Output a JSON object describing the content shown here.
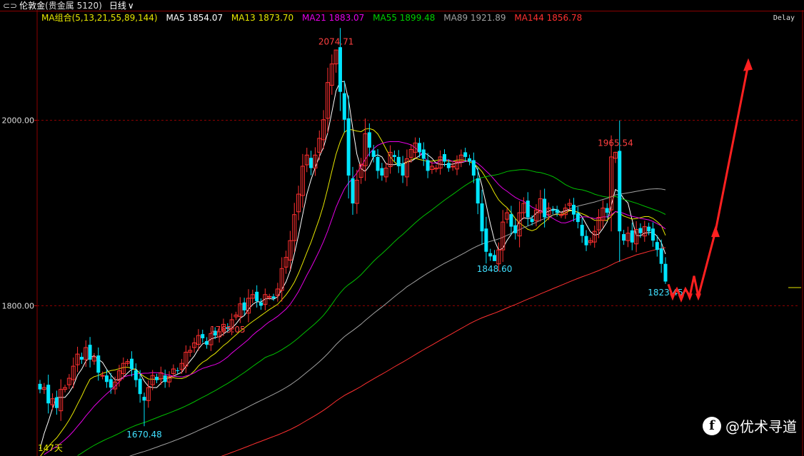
{
  "header": {
    "icon": "link-icon",
    "instrument": "伦敦金",
    "market": "(贵金属 5120)",
    "period": "日线",
    "dropdown_icon": "chevron-down-icon"
  },
  "ma_bar": {
    "label": "MA组合(5,13,21,55,89,144)",
    "items": [
      {
        "text": "MA5 1854.07",
        "color": "#ffffff"
      },
      {
        "text": "MA13 1873.70",
        "color": "#e6e600"
      },
      {
        "text": "MA21 1883.07",
        "color": "#e600e6"
      },
      {
        "text": "MA55 1899.48",
        "color": "#00d000"
      },
      {
        "text": "MA89 1921.89",
        "color": "#a0a0a0"
      },
      {
        "text": "MA144 1856.78",
        "color": "#ff3030"
      }
    ],
    "label_color": "#e6e600"
  },
  "delay_label": "Delay",
  "day_count": "147天",
  "watermark": {
    "logo": "f",
    "text": "@优术寻道"
  },
  "colors": {
    "up": "#ff3030",
    "down": "#00e5ff",
    "grid": "#8b0000"
  },
  "chart_data": {
    "type": "candlestick",
    "ylim": [
      1643,
      2118
    ],
    "y_ticks": [
      {
        "value": 2000,
        "label": "2000.00"
      },
      {
        "value": 1800,
        "label": "1800.00"
      }
    ],
    "grid_lines": [
      2000,
      1800
    ],
    "ohlc_close": [
      1710,
      1712,
      1695,
      1700,
      1690,
      1710,
      1712,
      1722,
      1735,
      1748,
      1742,
      1755,
      1742,
      1745,
      1728,
      1725,
      1718,
      1712,
      1718,
      1730,
      1738,
      1740,
      1732,
      1720,
      1705,
      1698,
      1712,
      1725,
      1720,
      1728,
      1718,
      1724,
      1732,
      1730,
      1738,
      1750,
      1752,
      1760,
      1768,
      1765,
      1758,
      1770,
      1768,
      1772,
      1780,
      1775,
      1785,
      1790,
      1802,
      1795,
      1808,
      1812,
      1805,
      1800,
      1812,
      1810,
      1808,
      1818,
      1840,
      1852,
      1870,
      1898,
      1920,
      1950,
      1962,
      1948,
      1962,
      1980,
      2000,
      2040,
      2060,
      2075,
      2030,
      2000,
      1940,
      1910,
      1935,
      1952,
      1985,
      1970,
      1960,
      1945,
      1940,
      1948,
      1965,
      1960,
      1950,
      1940,
      1958,
      1968,
      1975,
      1965,
      1958,
      1945,
      1950,
      1948,
      1960,
      1955,
      1948,
      1950,
      1955,
      1962,
      1960,
      1955,
      1940,
      1910,
      1880,
      1858,
      1853,
      1848,
      1860,
      1890,
      1900,
      1885,
      1878,
      1900,
      1910,
      1895,
      1890,
      1903,
      1915,
      1895,
      1905,
      1902,
      1900,
      1898,
      1905,
      1910,
      1898,
      1890,
      1875,
      1865,
      1870,
      1880,
      1895,
      1905,
      1900,
      1960,
      1965,
      1880,
      1870,
      1878,
      1868,
      1882,
      1878,
      1885,
      1880,
      1870,
      1860,
      1845,
      1823
    ],
    "annotations": [
      {
        "label": "2074.71",
        "value": 2074.71,
        "type": "high",
        "color": "#ff4040"
      },
      {
        "label": "1765.05",
        "value": 1765.05,
        "type": "high",
        "color": "#ff4040"
      },
      {
        "label": "1965.54",
        "value": 1965.54,
        "type": "high",
        "color": "#ff4040"
      },
      {
        "label": "1848.60",
        "value": 1848.6,
        "type": "low",
        "color": "#40e0ff"
      },
      {
        "label": "1670.48",
        "value": 1670.48,
        "type": "low",
        "color": "#40e0ff"
      },
      {
        "label": "1823.45",
        "value": 1823.45,
        "type": "low",
        "color": "#40e0ff"
      }
    ],
    "moving_averages": [
      {
        "name": "MA5",
        "period": 5,
        "color": "#ffffff"
      },
      {
        "name": "MA13",
        "period": 13,
        "color": "#e6e600"
      },
      {
        "name": "MA21",
        "period": 21,
        "color": "#e600e6"
      },
      {
        "name": "MA55",
        "period": 55,
        "color": "#00c000"
      },
      {
        "name": "MA89",
        "period": 89,
        "color": "#a0a0a0"
      },
      {
        "name": "MA144",
        "period": 144,
        "color": "#ff3030"
      }
    ],
    "forecast_path": [
      1823,
      1810,
      1818,
      1808,
      1818,
      1810,
      1832,
      1810,
      1880,
      2060
    ],
    "grid": true
  }
}
